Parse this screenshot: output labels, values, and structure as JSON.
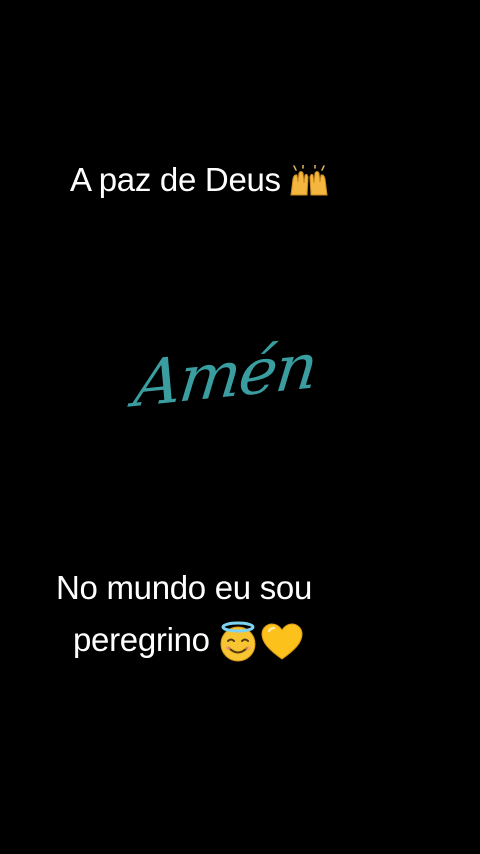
{
  "captions": {
    "top": "A paz de Deus",
    "bottom_line1": "No mundo eu sou",
    "bottom_line2": "peregrino"
  },
  "artwork": {
    "text": "Amén",
    "color": "#3a9ea0"
  },
  "icons": {
    "top_emoji": "raising-hands-icon",
    "bottom_emoji_1": "smiling-face-with-halo-icon",
    "bottom_emoji_2": "yellow-heart-icon"
  },
  "colors": {
    "background": "#000000",
    "caption_text": "#ffffff"
  }
}
